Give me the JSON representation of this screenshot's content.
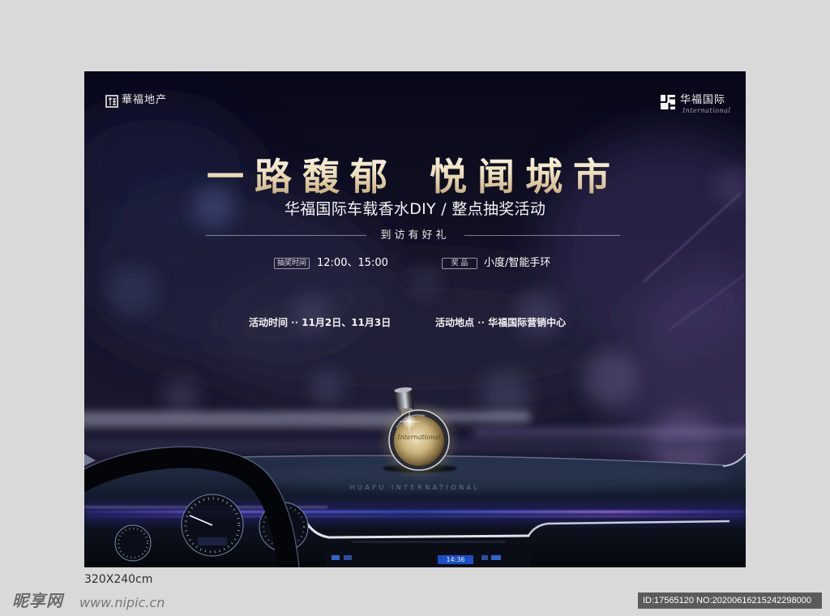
{
  "colors": {
    "page_background": "#d9d9d9",
    "poster_background": "#0d0c1f",
    "headline_gold": "#ecdcb8",
    "text_white": "#f4f4f4",
    "id_bar": "#5b5b5b",
    "clock_screen": "#1c4fc4"
  },
  "poster": {
    "logo_left": {
      "icon": "huafu-realty-logo-icon",
      "name": "華福地产"
    },
    "logo_right": {
      "icon": "huafu-international-logo-icon",
      "name": "华福国际",
      "script": "International"
    },
    "headline": {
      "part1": "一路馥郁",
      "part2": "悦闻城市"
    },
    "subtitle": "华福国际车载香水DIY / 整点抽奖活动",
    "gift_line": "到访有好礼",
    "draw_time": {
      "label": "抽奖时间",
      "value": "12:00、15:00"
    },
    "prize": {
      "label": "奖 品",
      "value": "小度/智能手环"
    },
    "event_time": {
      "label": "活动时间",
      "separator": "··",
      "value": "11月2日、11月3日"
    },
    "event_place": {
      "label": "活动地点",
      "separator": "··",
      "value": "华福国际营销中心"
    },
    "scene": {
      "bottle_icon": "perfume-bottle-icon",
      "bottle_script": "International",
      "dashboard_text": "HUAFU INTERNATIONAL",
      "dashboard_clock": "14:36"
    }
  },
  "size_label": "320X240cm",
  "watermark": {
    "brand": "昵享网",
    "url": "www.nipic.cn"
  },
  "image_id": "ID:17565120 NO:20200616215242298000"
}
